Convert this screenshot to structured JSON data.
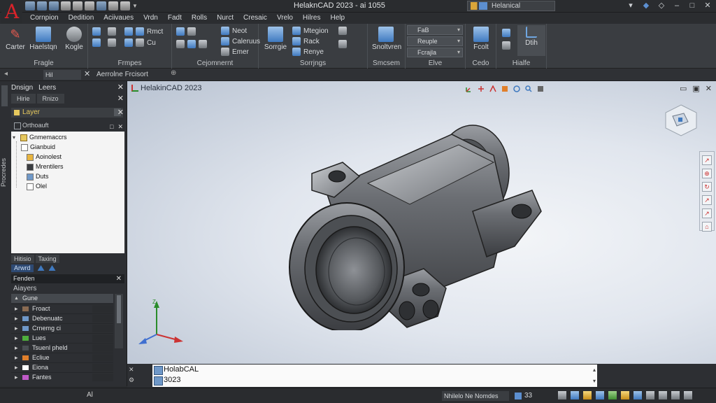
{
  "app": {
    "title": "HelaknCAD 2023 - ai 1055",
    "logo_letter": "A",
    "brand_color": "#d8232a",
    "search_value": "Helanical"
  },
  "menu": [
    "Cornpion",
    "Dedition",
    "Aciivaues",
    "Vrdn",
    "Fadt",
    "Rolls",
    "Nurct",
    "Cresaic",
    "Vrelo",
    "Hilres",
    "Help"
  ],
  "ribbon": {
    "panels": [
      {
        "title": "Fragle",
        "buttons": [
          "Carter",
          "Haelstqn",
          "Kogle"
        ]
      },
      {
        "title": "Frmpes",
        "rows": [
          "Rmct",
          "Cu"
        ]
      },
      {
        "title": "Cejomnernt",
        "rows": [
          "Neot",
          "Caleruus",
          "Emer"
        ]
      },
      {
        "title": "Sorrjngs",
        "buttons": [
          "Sorrgie"
        ],
        "rows": [
          "Mtegion",
          "Rack",
          "Renye"
        ]
      },
      {
        "title": "Smcsem",
        "buttons": [
          "Snoltvren"
        ]
      },
      {
        "title": "Elve",
        "dropdowns": [
          "FaB",
          "Reuple",
          "Fcrajla"
        ]
      },
      {
        "title": "Cedo",
        "buttons": [
          "Fcolt"
        ]
      },
      {
        "title": "Hialfe",
        "buttons": [
          "Dtih"
        ]
      }
    ]
  },
  "cmdrow": {
    "field": "Hil",
    "combo": "Aerrolne Frcisort"
  },
  "left": {
    "vertical_tab": "Procredes",
    "design_tabs": [
      "Dnsign",
      "Leers"
    ],
    "subtabs": [
      "Hirie",
      "Rnizo"
    ],
    "layers_label": "Layer",
    "ortho_label": "Orthoauft",
    "tree": {
      "root": "Gnmemaccrs",
      "group": "Gianbuid",
      "items": [
        "Aoinolest",
        "Mrentilers",
        "Duts",
        "Olel"
      ]
    },
    "filter_tabs": [
      "Hitisio",
      "Taxing"
    ],
    "filter_chip": "Arwrd",
    "properties": {
      "head": "Fenden",
      "sub": "Aiayers",
      "selected": "Gune",
      "rows": [
        {
          "label": "Froact",
          "color": "#8a6b52"
        },
        {
          "label": "Debenuatc",
          "color": "#6f98c8"
        },
        {
          "label": "Crnemg ci",
          "color": "#6f98c8"
        },
        {
          "label": "Lues",
          "color": "#4fae3d"
        },
        {
          "label": "Tsuenl pheld",
          "color": "#4a4e53"
        },
        {
          "label": "Ecliue",
          "color": "#e07f2b"
        },
        {
          "label": "Eiona",
          "color": "#ffffff"
        },
        {
          "label": "Fantes",
          "color": "#c05ac8"
        }
      ]
    }
  },
  "viewport": {
    "title": "HelakinCAD 2023",
    "background": "#e6eaf0",
    "part_color": "#5a5c60"
  },
  "command": {
    "lines": [
      "HolabCAL",
      "3023"
    ]
  },
  "status": {
    "left": "Al",
    "model": "Nhilelo Ne Nomdes",
    "scale": "33"
  }
}
